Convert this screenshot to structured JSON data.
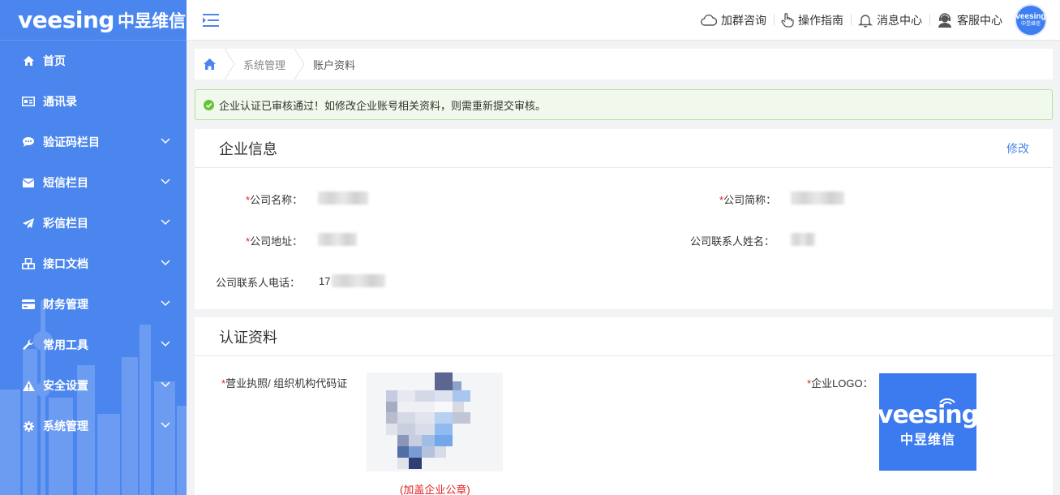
{
  "brand": {
    "name_en": "veesing",
    "name_cn": "中昱维信"
  },
  "sidebar": {
    "items": [
      {
        "label": "首页",
        "icon": "home-icon",
        "expandable": false
      },
      {
        "label": "通讯录",
        "icon": "contacts-icon",
        "expandable": false
      },
      {
        "label": "验证码栏目",
        "icon": "chat-bubble-icon",
        "expandable": true
      },
      {
        "label": "短信栏目",
        "icon": "envelope-icon",
        "expandable": true
      },
      {
        "label": "彩信栏目",
        "icon": "paper-plane-icon",
        "expandable": true
      },
      {
        "label": "接口文档",
        "icon": "cubes-icon",
        "expandable": true
      },
      {
        "label": "财务管理",
        "icon": "credit-card-icon",
        "expandable": true
      },
      {
        "label": "常用工具",
        "icon": "wrench-icon",
        "expandable": true
      },
      {
        "label": "安全设置",
        "icon": "warning-icon",
        "expandable": true
      },
      {
        "label": "系统管理",
        "icon": "gear-icon",
        "expandable": true
      }
    ]
  },
  "topbar": {
    "actions": [
      {
        "label": "加群咨询",
        "icon": "cloud-icon"
      },
      {
        "label": "操作指南",
        "icon": "hand-pointer-icon"
      },
      {
        "label": "消息中心",
        "icon": "bell-icon"
      },
      {
        "label": "客服中心",
        "icon": "customer-service-icon"
      }
    ],
    "avatar": {
      "line1": "veesing",
      "line2": "中昱维信"
    }
  },
  "breadcrumb": {
    "items": [
      "系统管理",
      "账户资料"
    ]
  },
  "alert": {
    "text": "企业认证已审核通过！如修改企业账号相关资料，则需重新提交审核。"
  },
  "company_info": {
    "title": "企业信息",
    "edit_label": "修改",
    "fields": {
      "name_label": "公司名称：",
      "short_name_label": "公司简称：",
      "address_label": "公司地址：",
      "contact_name_label": "公司联系人姓名：",
      "contact_phone_label": "公司联系人电话：",
      "contact_phone_value": "17"
    },
    "required_mark": "*"
  },
  "certification": {
    "title": "认证资料",
    "license_label": "营业执照/ 组织机构代码证",
    "logo_label": "企业LOGO：",
    "stamp_note": "(加盖企业公章)",
    "required_mark": "*"
  },
  "colors": {
    "sidebar": "#4a86ee",
    "accent": "#4a86ee",
    "success_bg": "#f0f9eb",
    "required": "#e02020"
  }
}
